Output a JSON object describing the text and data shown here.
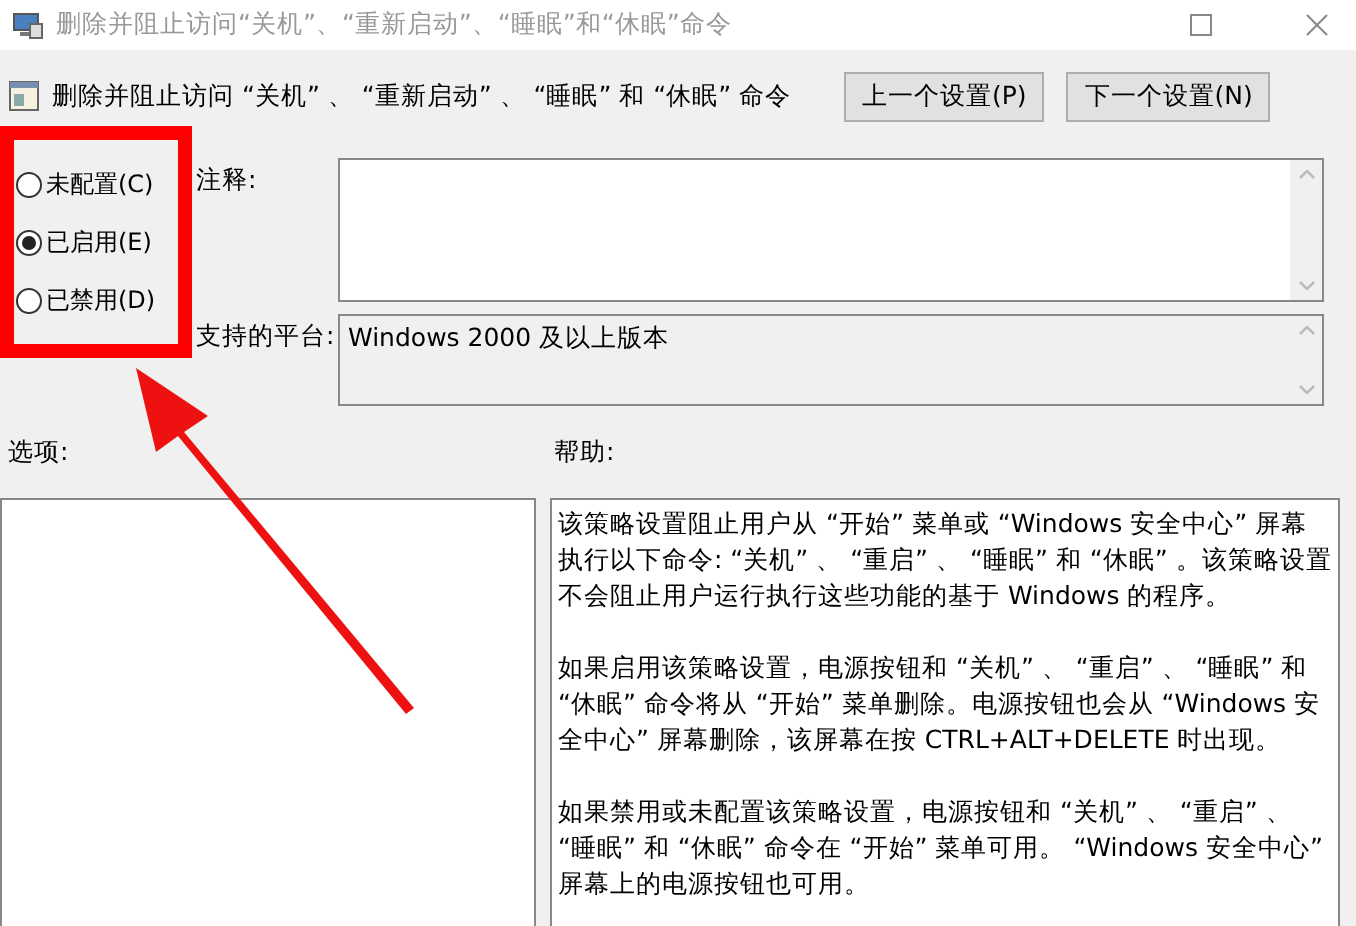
{
  "window": {
    "title": "删除并阻止访问“关机”、“重新启动”、“睡眠”和“休眠”命令"
  },
  "setting_title": "删除并阻止访问 “关机” 、 “重新启动” 、 “睡眠” 和 “休眠” 命令",
  "buttons": [
    {
      "label": "上一个设置(P)"
    },
    {
      "label": "下一个设置(N)"
    }
  ],
  "options": [
    {
      "label": "未配置(C)",
      "selected": false
    },
    {
      "label": "已启用(E)",
      "selected": true
    },
    {
      "label": "已禁用(D)",
      "selected": false
    }
  ],
  "comment": {
    "label": "注释:"
  },
  "platform": {
    "label": "支持的平台:",
    "value": "Windows 2000 及以上版本"
  },
  "options_label": "选项:",
  "help_label": "帮助:",
  "help_paragraphs": [
    "该策略设置阻止用户从 “开始” 菜单或 “Windows 安全中心” 屏幕执行以下命令: “关机” 、 “重启” 、 “睡眠” 和 “休眠” 。该策略设置不会阻止用户运行执行这些功能的基于 Windows 的程序。",
    "如果启用该策略设置，电源按钮和 “关机” 、 “重启” 、 “睡眠” 和 “休眠” 命令将从 “开始” 菜单删除。电源按钮也会从 “Windows 安全中心” 屏幕删除，该屏幕在按 CTRL+ALT+DELETE 时出现。",
    "如果禁用或未配置该策略设置，电源按钮和 “关机” 、 “重启” 、 “睡眠” 和 “休眠” 命令在 “开始” 菜单可用。 “Windows 安全中心” 屏幕上的电源按钮也可用。"
  ]
}
